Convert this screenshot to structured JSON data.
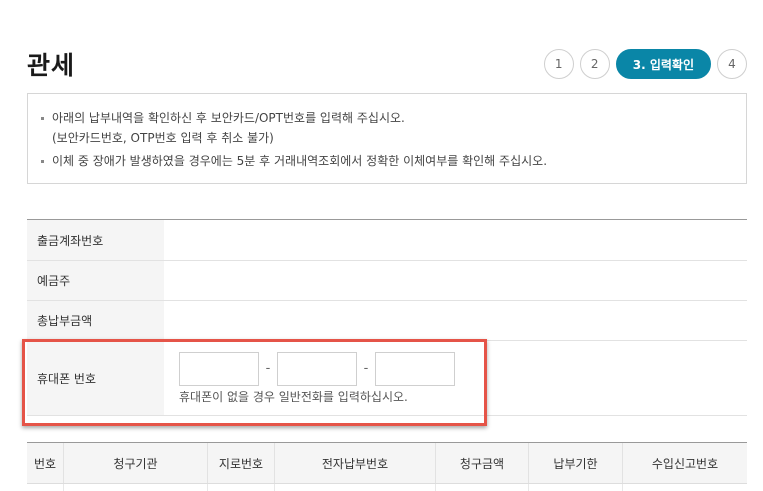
{
  "page": {
    "title": "관세"
  },
  "steps": [
    {
      "label": "1",
      "active": false
    },
    {
      "label": "2",
      "active": false
    },
    {
      "label": "3. 입력확인",
      "active": true
    },
    {
      "label": "4",
      "active": false
    }
  ],
  "notice": {
    "item1": "아래의 납부내역을 확인하신 후 보안카드/OPT번호를 입력해 주십시오.",
    "item1_sub": "(보안카드번호, OTP번호 입력 후 취소 불가)",
    "item2": "이체 중 장애가 발생하였을 경우에는 5분 후 거래내역조회에서 정확한 이체여부를 확인해 주십시오."
  },
  "info": {
    "account_label": "출금계좌번호",
    "account_value": "",
    "holder_label": "예금주",
    "holder_value": "",
    "total_label": "총납부금액",
    "total_value": "",
    "phone_label": "휴대폰 번호",
    "phone_part1": "",
    "phone_part2": "",
    "phone_part3": "",
    "phone_dash": "-",
    "phone_help": "휴대폰이 없을 경우 일반전화를 입력하십시오."
  },
  "bill_table": {
    "headers": [
      "번호",
      "청구기관",
      "지로번호",
      "전자납부번호",
      "청구금액",
      "납부기한",
      "수입신고번호"
    ]
  },
  "colors": {
    "accent": "#0a86a7",
    "highlight": "#e55448"
  }
}
